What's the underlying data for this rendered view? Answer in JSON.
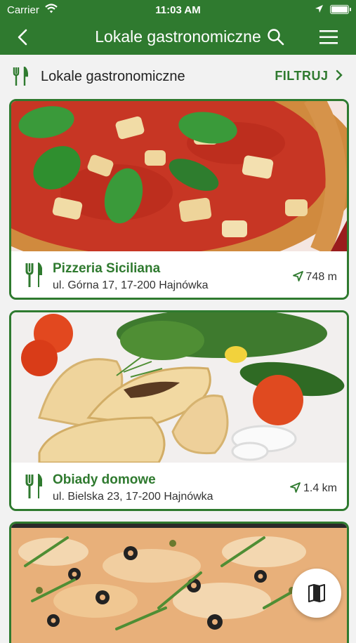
{
  "status_bar": {
    "carrier": "Carrier",
    "time": "11:03 AM"
  },
  "nav": {
    "title": "Lokale gastronomiczne",
    "back_icon": "chevron-left-icon",
    "search_icon": "search-icon",
    "menu_icon": "hamburger-menu-icon"
  },
  "subheader": {
    "label": "Lokale gastronomiczne",
    "filter_label": "FILTRUJ",
    "filter_icon": "chevron-right-icon"
  },
  "places": [
    {
      "name": "Pizzeria Siciliana",
      "address": "ul. Górna 17, 17-200 Hajnówka",
      "distance": "748 m",
      "photo": "pizza-photo"
    },
    {
      "name": "Obiady domowe",
      "address": "ul. Bielska 23, 17-200 Hajnówka",
      "distance": "1.4 km",
      "photo": "dumplings-photo"
    },
    {
      "photo": "pizza-photo"
    }
  ],
  "fab": {
    "icon": "map-icon"
  },
  "colors": {
    "brand_green": "#2f7a2f",
    "background": "#f2f2f2"
  }
}
